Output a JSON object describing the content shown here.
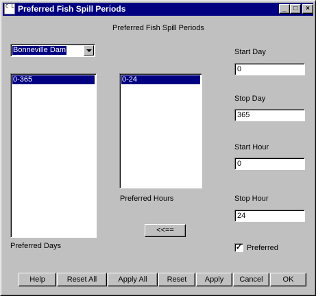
{
  "window": {
    "title": "Preferred Fish Spill Periods",
    "icon_text": "C L",
    "controls": {
      "minimize": "_",
      "maximize": "□",
      "close": "×"
    }
  },
  "header": {
    "label": "Preferred Fish Spill Periods"
  },
  "dam_select": {
    "selected": "Bonneville Dam"
  },
  "days_list": {
    "label": "Preferred Days",
    "items": [
      "0-365"
    ]
  },
  "hours_list": {
    "label": "Preferred Hours",
    "items": [
      "0-24"
    ]
  },
  "move_button": {
    "label": "<<=="
  },
  "fields": {
    "start_day": {
      "label": "Start Day",
      "value": "0"
    },
    "stop_day": {
      "label": "Stop Day",
      "value": "365"
    },
    "start_hour": {
      "label": "Start Hour",
      "value": "0"
    },
    "stop_hour": {
      "label": "Stop Hour",
      "value": "24"
    }
  },
  "preferred_checkbox": {
    "label": "Preferred",
    "checked": true,
    "mark": "✓"
  },
  "buttons": {
    "help": "Help",
    "reset_all": "Reset All",
    "apply_all": "Apply All",
    "reset": "Reset",
    "apply": "Apply",
    "cancel": "Cancel",
    "ok": "OK"
  }
}
